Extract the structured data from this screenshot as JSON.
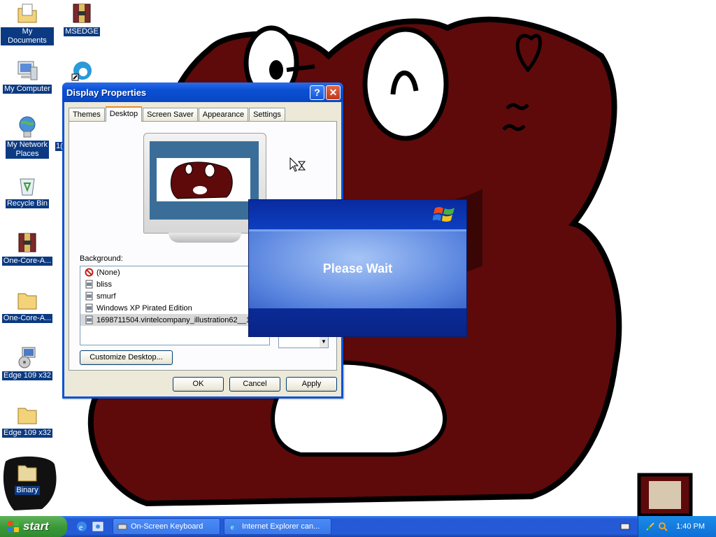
{
  "desktop": {
    "icons": [
      {
        "label": "My Documents",
        "icon": "my-documents-icon"
      },
      {
        "label": "MSEDGE",
        "icon": "archive-icon"
      },
      {
        "label": "My Computer",
        "icon": "my-computer-icon"
      },
      {
        "label": "My Network\nPlaces",
        "icon": "network-places-icon"
      },
      {
        "label": "Recycle Bin",
        "icon": "recycle-bin-icon"
      },
      {
        "label": "One-Core-A...",
        "icon": "archive-icon"
      },
      {
        "label": "One-Core-A...",
        "icon": "folder-icon"
      },
      {
        "label": "Edge 109 x32",
        "icon": "installer-icon"
      },
      {
        "label": "Edge 109 x32",
        "icon": "folder-icon"
      },
      {
        "label": "Binary",
        "icon": "folder-icon"
      }
    ],
    "partial_label": "1("
  },
  "display_properties": {
    "title": "Display Properties",
    "help_glyph": "?",
    "close_glyph": "✕",
    "tabs": [
      "Themes",
      "Desktop",
      "Screen Saver",
      "Appearance",
      "Settings"
    ],
    "active_tab": "Desktop",
    "background_label": "Background:",
    "backgrounds": [
      {
        "name": "(None)",
        "icon": "none-icon"
      },
      {
        "name": "bliss",
        "icon": "image-file-icon"
      },
      {
        "name": "smurf",
        "icon": "image-file-icon"
      },
      {
        "name": "Windows XP Pirated Edition",
        "icon": "image-file-icon"
      },
      {
        "name": "1698711504.vintelcompany_illustration62__1_",
        "icon": "image-file-icon",
        "selected": true
      }
    ],
    "customize_button": "Customize Desktop...",
    "ok_button": "OK",
    "cancel_button": "Cancel",
    "apply_button": "Apply"
  },
  "please_wait": {
    "text": "Please Wait"
  },
  "taskbar": {
    "start_label": "start",
    "tasks": [
      {
        "label": "On-Screen Keyboard",
        "icon": "keyboard-icon"
      },
      {
        "label": "Internet Explorer can...",
        "icon": "internet-explorer-icon"
      }
    ],
    "clock": "1:40 PM"
  },
  "colors": {
    "wallpaper_maroon": "#5e0a0a",
    "xp_title_blue": "#0a4fd2",
    "start_green": "#3c9a3a"
  }
}
